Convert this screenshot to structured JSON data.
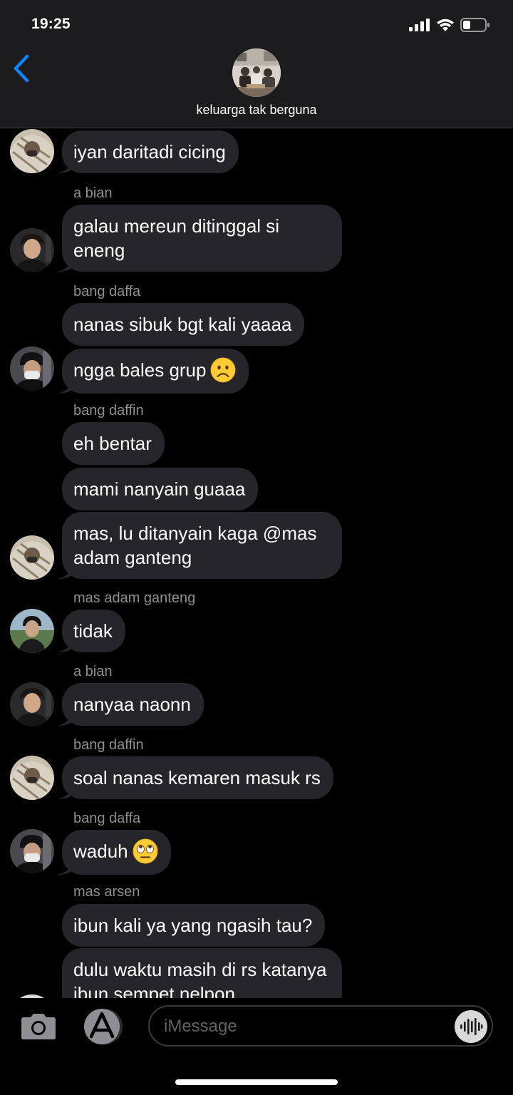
{
  "status": {
    "time": "19:25"
  },
  "header": {
    "group_name": "keluarga tak berguna"
  },
  "messages": [
    {
      "sender": "",
      "text": "iyan daritadi cicing",
      "avatar": "bang-daffin"
    },
    {
      "sender": "a bian",
      "text": "galau mereun ditinggal si eneng",
      "avatar": "a-bian"
    },
    {
      "sender": "bang daffa",
      "text": "nanas sibuk bgt kali yaaaa",
      "avatar": ""
    },
    {
      "sender": "",
      "text": "ngga bales grup",
      "emoji": "frowning-face-emoji",
      "avatar": "bang-daffa"
    },
    {
      "sender": "bang daffin",
      "text": "eh bentar",
      "avatar": ""
    },
    {
      "sender": "",
      "text": "mami nanyain guaaa",
      "avatar": ""
    },
    {
      "sender": "",
      "text": "mas, lu ditanyain kaga @mas adam ganteng",
      "avatar": "bang-daffin"
    },
    {
      "sender": "mas adam ganteng",
      "text": "tidak",
      "avatar": "mas-adam"
    },
    {
      "sender": "a bian",
      "text": "nanyaa naonn",
      "avatar": "a-bian"
    },
    {
      "sender": "bang daffin",
      "text": "soal nanas kemaren masuk rs",
      "avatar": "bang-daffin"
    },
    {
      "sender": "bang daffa",
      "text": "waduh",
      "emoji": "eye-roll-emoji",
      "avatar": "bang-daffa"
    },
    {
      "sender": "mas arsen",
      "text": "ibun kali ya yang ngasih tau?",
      "avatar": ""
    },
    {
      "sender": "",
      "text": "dulu waktu masih di rs katanya ibun sempet nelpon",
      "avatar": ""
    }
  ],
  "input": {
    "placeholder": "iMessage"
  },
  "colors": {
    "bubble": "#26252a",
    "accent": "#0a84ff",
    "header": "#1c1c1e"
  }
}
